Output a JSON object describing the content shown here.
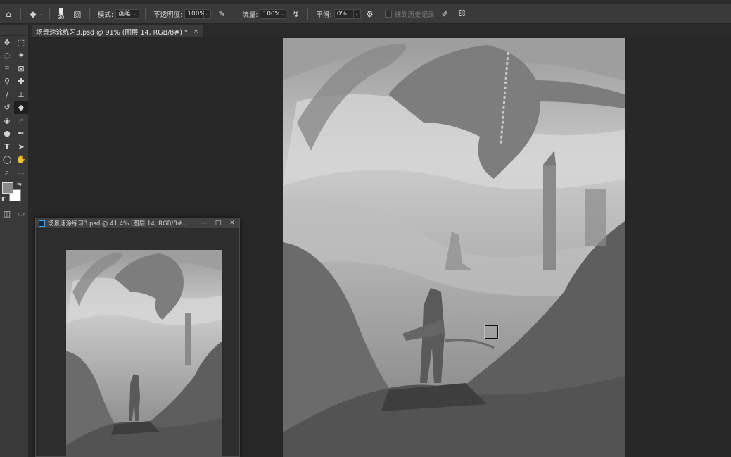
{
  "options_bar": {
    "brush_size": "30",
    "mode_label": "模式:",
    "mode_value": "画笔",
    "opacity_label": "不透明度:",
    "opacity_value": "100%",
    "flow_label": "流量:",
    "flow_value": "100%",
    "smoothing_label": "平滑:",
    "smoothing_value": "0%",
    "erase_history_label": "抹到历史记录"
  },
  "document_tab": {
    "title": "场景速涂练习3.psd @ 91% (图层 14, RGB/8#) *",
    "close": "×"
  },
  "floating_window": {
    "title": "场景速涂练习3.psd @ 41.4% (图层 14, RGB/8#...",
    "minimize": "—",
    "restore": "□",
    "close": "✕"
  },
  "colors": {
    "foreground": "#8a8a8a",
    "background": "#ffffff",
    "accent": "#31a8ff"
  },
  "icons": {
    "home": "home-icon",
    "eraser": "eraser-icon",
    "brush_panel": "brush-settings-icon",
    "pressure_opacity": "pressure-opacity-icon",
    "airbrush": "airbrush-icon",
    "settings": "gear-icon",
    "pressure_size": "pressure-size-icon",
    "symmetry": "butterfly-symmetry-icon"
  }
}
